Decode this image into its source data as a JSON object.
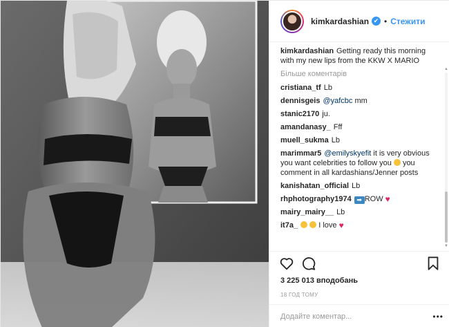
{
  "header": {
    "username": "kimkardashian",
    "verified_symbol": "✔",
    "separator": "•",
    "follow_label": "Стежити"
  },
  "caption": {
    "username": "kimkardashian",
    "text": "Getting ready this morning with my new lips from the KKW X MARIO"
  },
  "more_comments_label": "Більше коментарів",
  "comments": [
    {
      "user": "cristiana_tf",
      "text": "Lb"
    },
    {
      "user": "dennisgeis",
      "mention": "@yafcbc",
      "text": "mm"
    },
    {
      "user": "stanic2170",
      "text": "ju."
    },
    {
      "user": "amandanasy_",
      "text": "Fff"
    },
    {
      "user": "muell_sukma",
      "text": "Lb"
    },
    {
      "user": "marimmar5",
      "mention": "@emilyskyefit",
      "text": "it is very obvious you want celebrities to follow you",
      "text2": "you comment in all kardashians/Jenner posts"
    },
    {
      "user": "kanishatan_official",
      "text": "Lb"
    },
    {
      "user": "rhphotography1974",
      "text": "ROW"
    },
    {
      "user": "mairy_mairy__",
      "text": "Lb"
    },
    {
      "user": "it7a_",
      "text": "I love"
    }
  ],
  "icons": {
    "like": "heart-outline",
    "comment": "speech-bubble",
    "save": "bookmark",
    "verified": "check-badge",
    "arrow_emoji": "right-arrow",
    "heart_emoji": "red-heart"
  },
  "likes_text": "3 225 013 вподобань",
  "time_ago": "18 ГОД ТОМУ",
  "add_comment_placeholder": "Додайте коментар...",
  "more_options_symbol": "•••",
  "colors": {
    "link": "#3897f0",
    "text": "#262626",
    "muted": "#999999",
    "heart": "#e0245e"
  }
}
